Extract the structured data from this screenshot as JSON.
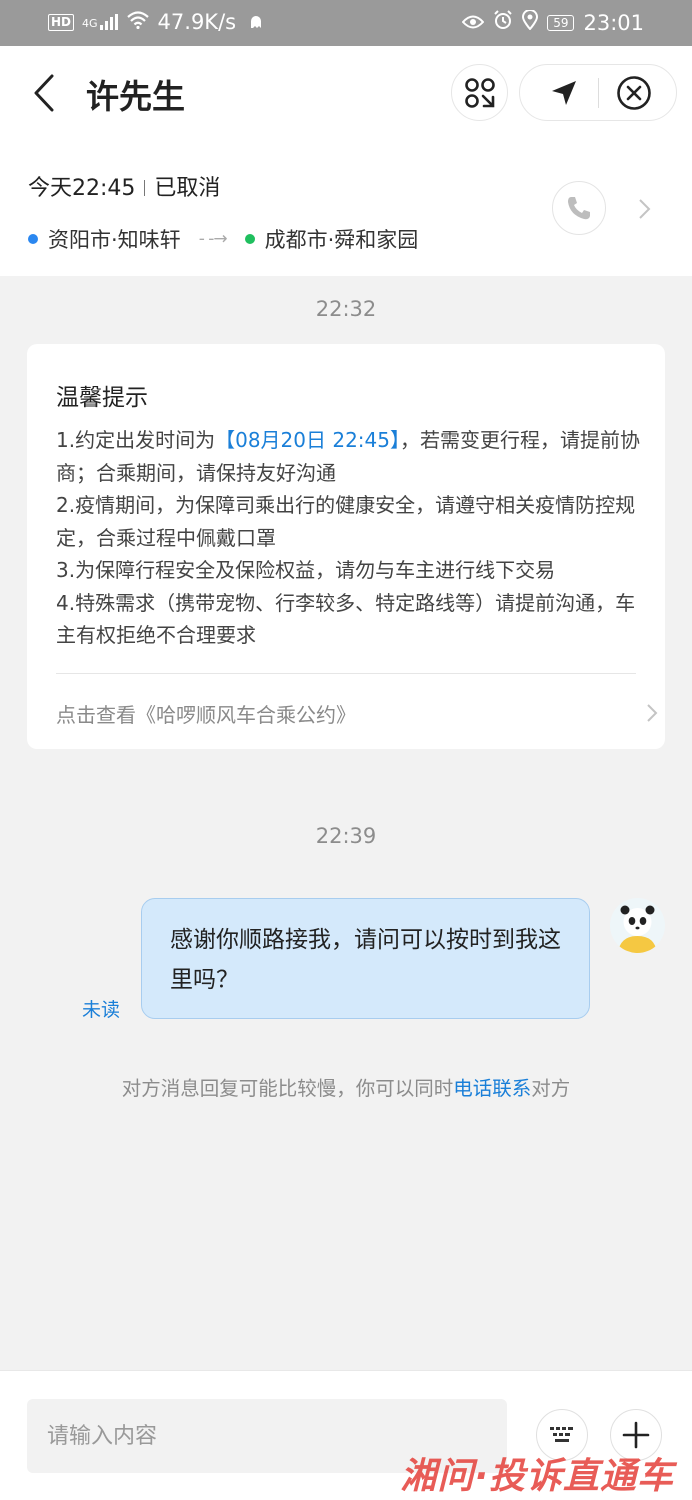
{
  "status_bar": {
    "hd_badge": "HD",
    "signal_label": "4G",
    "net_speed": "47.9K/s",
    "battery": "59",
    "time": "23:01",
    "icons": [
      "hd-icon",
      "signal-icon",
      "wifi-icon",
      "ghost-icon",
      "eye-icon",
      "alarm-icon",
      "location-icon",
      "battery-icon"
    ]
  },
  "header": {
    "title": "许先生",
    "icons": [
      "back-icon",
      "scan-icon",
      "navigation-icon",
      "close-circle-icon"
    ]
  },
  "trip": {
    "time": "今天22:45",
    "status": "已取消",
    "origin": "资阳市·知味轩",
    "destination": "成都市·舜和家园",
    "origin_color": "#2a87f0",
    "destination_color": "#1fbf5e"
  },
  "chat": {
    "timestamp_1": "22:32",
    "notice": {
      "title": "温馨提示",
      "item1_prefix": "1.约定出发时间为",
      "item1_highlight": "【08月20日 22:45】",
      "item1_suffix": "，若需变更行程，请提前协商；合乘期间，请保持友好沟通",
      "item2": "2.疫情期间，为保障司乘出行的健康安全，请遵守相关疫情防控规定，合乘过程中佩戴口罩",
      "item3": "3.为保障行程安全及保险权益，请勿与车主进行线下交易",
      "item4": "4.特殊需求（携带宠物、行李较多、特定路线等）请提前沟通，车主有权拒绝不合理要求",
      "link": "点击查看《哈啰顺风车合乘公约》"
    },
    "timestamp_2": "22:39",
    "message": {
      "text": "感谢你顺路接我，请问可以按时到我这里吗？",
      "status": "未读"
    },
    "hint_prefix": "对方消息回复可能比较慢，你可以同时",
    "hint_link": "电话联系",
    "hint_suffix": "对方"
  },
  "input_bar": {
    "placeholder": "请输入内容"
  },
  "watermark": "湘问·投诉直通车",
  "colors": {
    "accent": "#1a7fd8",
    "bubble": "#d4e9fb",
    "background": "#f2f2f2"
  }
}
